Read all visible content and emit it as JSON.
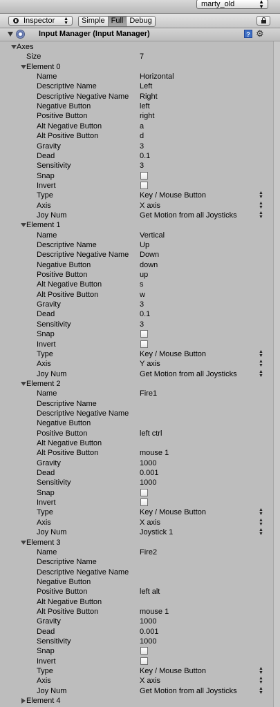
{
  "layout": {
    "selected": "marty_old"
  },
  "toolbar": {
    "tab_label": "Inspector",
    "modes": [
      "Simple",
      "Full",
      "Debug"
    ],
    "active_mode": "Full"
  },
  "component": {
    "title": "Input Manager (Input Manager)",
    "help": "?"
  },
  "axes": {
    "label": "Axes",
    "size_label": "Size",
    "size": "7",
    "elements": [
      {
        "label": "Element 0",
        "props": [
          {
            "k": "Name",
            "v": "Horizontal"
          },
          {
            "k": "Descriptive Name",
            "v": "Left"
          },
          {
            "k": "Descriptive Negative Name",
            "v": "Right"
          },
          {
            "k": "Negative Button",
            "v": "left"
          },
          {
            "k": "Positive Button",
            "v": "right"
          },
          {
            "k": "Alt Negative Button",
            "v": "a"
          },
          {
            "k": "Alt Positive Button",
            "v": "d"
          },
          {
            "k": "Gravity",
            "v": "3"
          },
          {
            "k": "Dead",
            "v": "0.1"
          },
          {
            "k": "Sensitivity",
            "v": "3"
          },
          {
            "k": "Snap",
            "t": "check"
          },
          {
            "k": "Invert",
            "t": "check"
          },
          {
            "k": "Type",
            "v": "Key / Mouse Button",
            "t": "dd"
          },
          {
            "k": "Axis",
            "v": "X axis",
            "t": "dd"
          },
          {
            "k": "Joy Num",
            "v": "Get Motion from all Joysticks",
            "t": "dd"
          }
        ]
      },
      {
        "label": "Element 1",
        "props": [
          {
            "k": "Name",
            "v": "Vertical"
          },
          {
            "k": "Descriptive Name",
            "v": "Up"
          },
          {
            "k": "Descriptive Negative Name",
            "v": "Down"
          },
          {
            "k": "Negative Button",
            "v": "down"
          },
          {
            "k": "Positive Button",
            "v": "up"
          },
          {
            "k": "Alt Negative Button",
            "v": "s"
          },
          {
            "k": "Alt Positive Button",
            "v": "w"
          },
          {
            "k": "Gravity",
            "v": "3"
          },
          {
            "k": "Dead",
            "v": "0.1"
          },
          {
            "k": "Sensitivity",
            "v": "3"
          },
          {
            "k": "Snap",
            "t": "check"
          },
          {
            "k": "Invert",
            "t": "check"
          },
          {
            "k": "Type",
            "v": "Key / Mouse Button",
            "t": "dd"
          },
          {
            "k": "Axis",
            "v": "Y axis",
            "t": "dd"
          },
          {
            "k": "Joy Num",
            "v": "Get Motion from all Joysticks",
            "t": "dd"
          }
        ]
      },
      {
        "label": "Element 2",
        "props": [
          {
            "k": "Name",
            "v": "Fire1"
          },
          {
            "k": "Descriptive Name",
            "v": ""
          },
          {
            "k": "Descriptive Negative Name",
            "v": ""
          },
          {
            "k": "Negative Button",
            "v": ""
          },
          {
            "k": "Positive Button",
            "v": "left ctrl"
          },
          {
            "k": "Alt Negative Button",
            "v": ""
          },
          {
            "k": "Alt Positive Button",
            "v": "mouse 1"
          },
          {
            "k": "Gravity",
            "v": "1000"
          },
          {
            "k": "Dead",
            "v": "0.001"
          },
          {
            "k": "Sensitivity",
            "v": "1000"
          },
          {
            "k": "Snap",
            "t": "check"
          },
          {
            "k": "Invert",
            "t": "check"
          },
          {
            "k": "Type",
            "v": "Key / Mouse Button",
            "t": "dd"
          },
          {
            "k": "Axis",
            "v": "X axis",
            "t": "dd"
          },
          {
            "k": "Joy Num",
            "v": "Joystick 1",
            "t": "dd"
          }
        ]
      },
      {
        "label": "Element 3",
        "props": [
          {
            "k": "Name",
            "v": "Fire2"
          },
          {
            "k": "Descriptive Name",
            "v": ""
          },
          {
            "k": "Descriptive Negative Name",
            "v": ""
          },
          {
            "k": "Negative Button",
            "v": ""
          },
          {
            "k": "Positive Button",
            "v": "left alt"
          },
          {
            "k": "Alt Negative Button",
            "v": ""
          },
          {
            "k": "Alt Positive Button",
            "v": "mouse 1"
          },
          {
            "k": "Gravity",
            "v": "1000"
          },
          {
            "k": "Dead",
            "v": "0.001"
          },
          {
            "k": "Sensitivity",
            "v": "1000"
          },
          {
            "k": "Snap",
            "t": "check"
          },
          {
            "k": "Invert",
            "t": "check"
          },
          {
            "k": "Type",
            "v": "Key / Mouse Button",
            "t": "dd"
          },
          {
            "k": "Axis",
            "v": "X axis",
            "t": "dd"
          },
          {
            "k": "Joy Num",
            "v": "Get Motion from all Joysticks",
            "t": "dd"
          }
        ]
      }
    ],
    "collapsed": [
      "Element 4"
    ]
  }
}
